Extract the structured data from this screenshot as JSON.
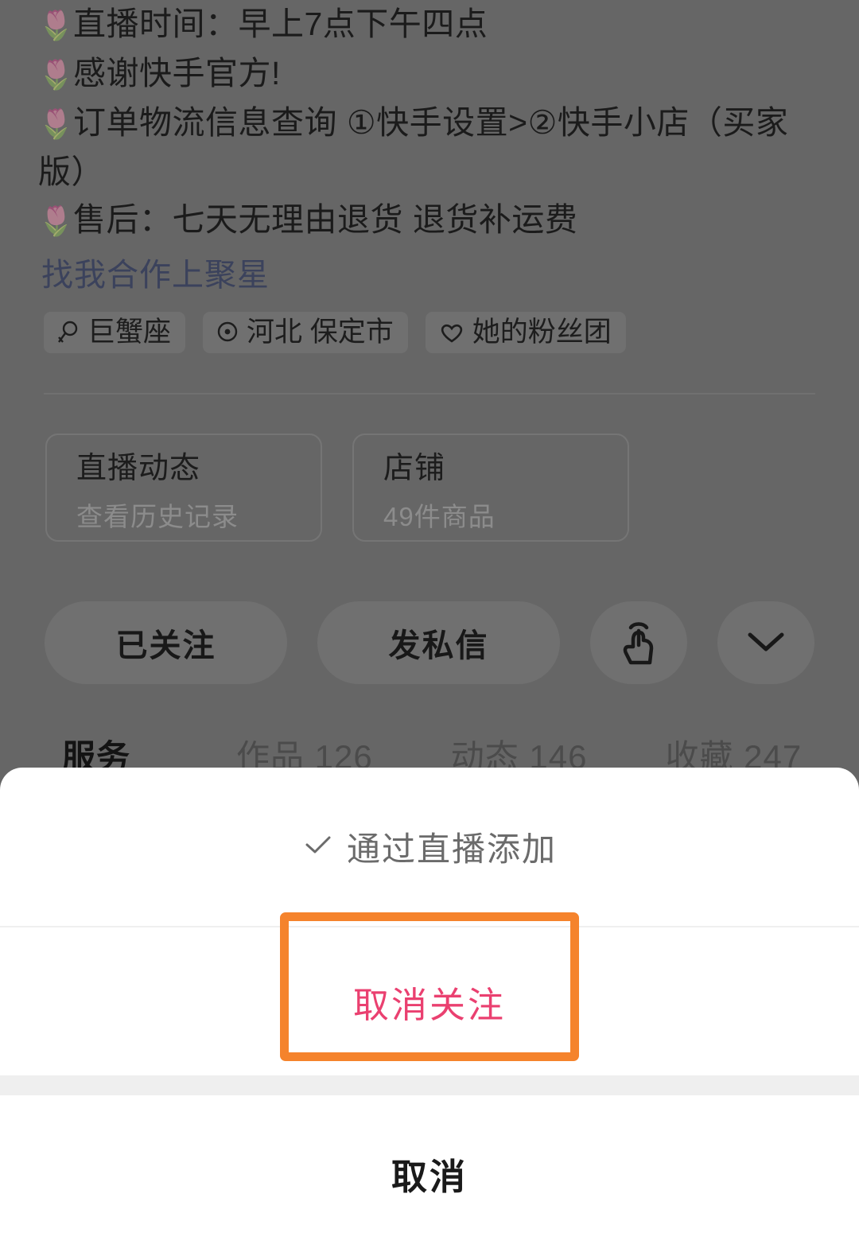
{
  "profile": {
    "bio_lines": [
      {
        "icon": "🌷",
        "text": "直播时间：早上7点下午四点"
      },
      {
        "icon": "🌷",
        "text": "感谢快手官方!"
      },
      {
        "icon": "🌷",
        "text": "订单物流信息查询 ①快手设置>②快手小店（买家版）"
      },
      {
        "icon": "🌷",
        "text": "售后：七天无理由退货 退货补运费"
      }
    ],
    "cooperation_link": "找我合作上聚星",
    "tags": [
      {
        "icon": "zodiac-icon",
        "label": "巨蟹座"
      },
      {
        "icon": "location-pin-icon",
        "label": "河北 保定市"
      },
      {
        "icon": "heart-icon",
        "label": "她的粉丝团"
      }
    ],
    "cards": [
      {
        "title": "直播动态",
        "subtitle": "查看历史记录"
      },
      {
        "title": "店铺",
        "subtitle": "49件商品"
      }
    ],
    "actions": {
      "follow_label": "已关注",
      "message_label": "发私信",
      "poke_icon": "tap-hand-icon",
      "more_icon": "chevron-down-icon"
    },
    "tabs": [
      {
        "label": "服务",
        "active": true
      },
      {
        "label": "作品 126",
        "active": false
      },
      {
        "label": "动态 146",
        "active": false
      },
      {
        "label": "收藏 247",
        "active": false
      }
    ]
  },
  "sheet": {
    "option_label": "通过直播添加",
    "option_icon": "check-icon",
    "unfollow_label": "取消关注",
    "cancel_label": "取消"
  },
  "colors": {
    "overlay": "#666666",
    "sheet_bg": "#ffffff",
    "unfollow_text": "#ea4070",
    "annotation_border": "#f5832c",
    "link_text": "#3b425c",
    "band": "#efefef"
  }
}
